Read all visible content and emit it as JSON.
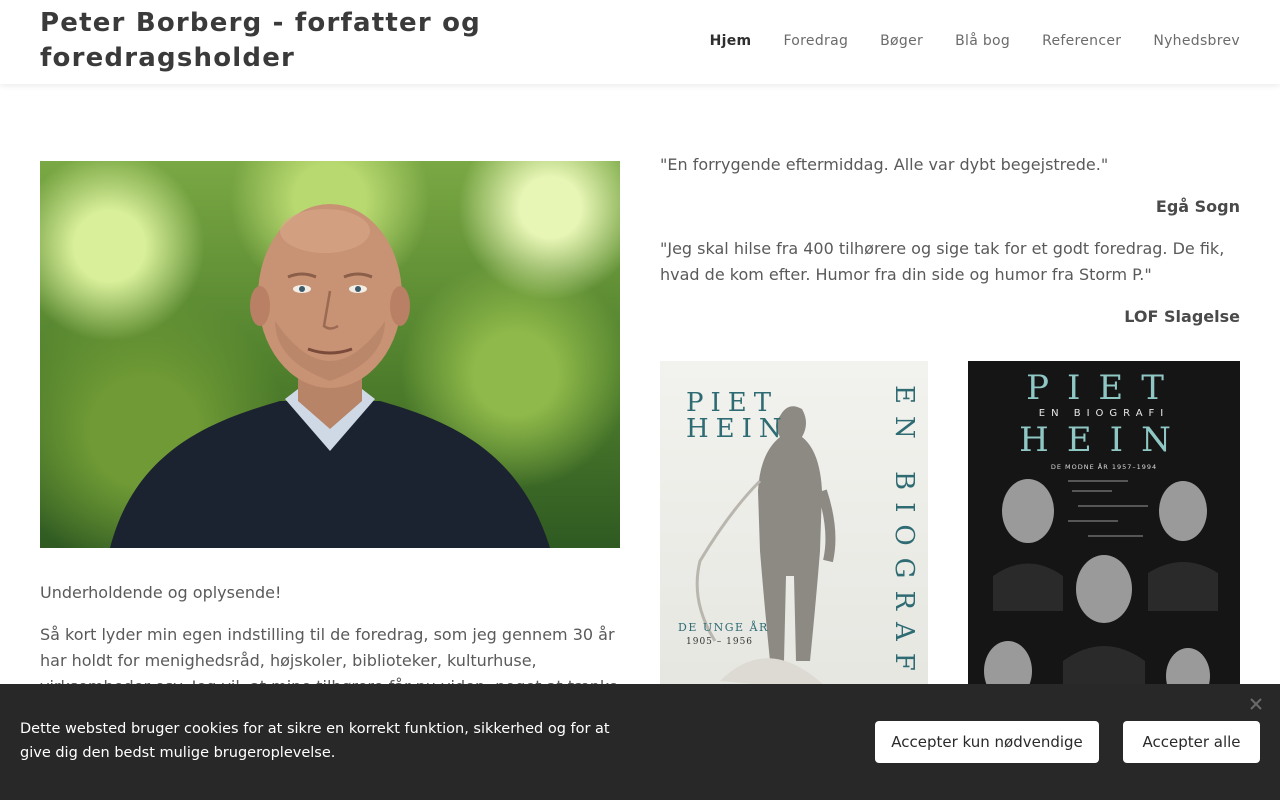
{
  "header": {
    "title": "Peter Borberg - forfatter og foredragsholder",
    "nav": [
      {
        "label": "Hjem",
        "active": true
      },
      {
        "label": "Foredrag"
      },
      {
        "label": "Bøger"
      },
      {
        "label": "Blå bog"
      },
      {
        "label": "Referencer"
      },
      {
        "label": "Nyhedsbrev"
      }
    ]
  },
  "intro": {
    "lead": "Underholdende og oplysende!",
    "body": "Så kort lyder min egen indstilling til de foredrag, som jeg gennem 30 år har holdt for menighedsråd, højskoler, biblioteker, kulturhuse, virksomheder osv. Jeg vil, at mine tilhørere får nu viden, noget at tænke over – og nogle"
  },
  "quotes": [
    {
      "text": "\"En forrygende eftermiddag. Alle var dybt begejstrede.\"",
      "source": "Egå Sogn"
    },
    {
      "text": "\"Jeg skal hilse fra 400 tilhørere og sige tak for et godt foredrag. De fik, hvad de kom efter. Humor fra din side og humor fra Storm P.\"",
      "source": "LOF Slagelse"
    }
  ],
  "books": [
    {
      "title_line1": "PIET",
      "title_line2": "HEIN",
      "vertical": "EN BIOGRAFI",
      "subtitle": "DE UNGE ÅR",
      "years": "1905 – 1956"
    },
    {
      "title_line1": "PIET",
      "title_mid": "EN BIOGRAFI",
      "title_line2": "HEIN",
      "subtitle": "DE MODNE ÅR   1957–1994"
    }
  ],
  "cookie": {
    "text": "Dette websted bruger cookies for at sikre en korrekt funktion, sikkerhed og for at give dig den bedst mulige brugeroplevelse.",
    "btn_necessary": "Accepter kun nødvendige",
    "btn_all": "Accepter alle",
    "close_icon": "close-icon"
  },
  "colors": {
    "banner_bg": "#282828",
    "book_title_teal": "#2f6b73",
    "book2_title_teal": "#8fc7c4"
  }
}
